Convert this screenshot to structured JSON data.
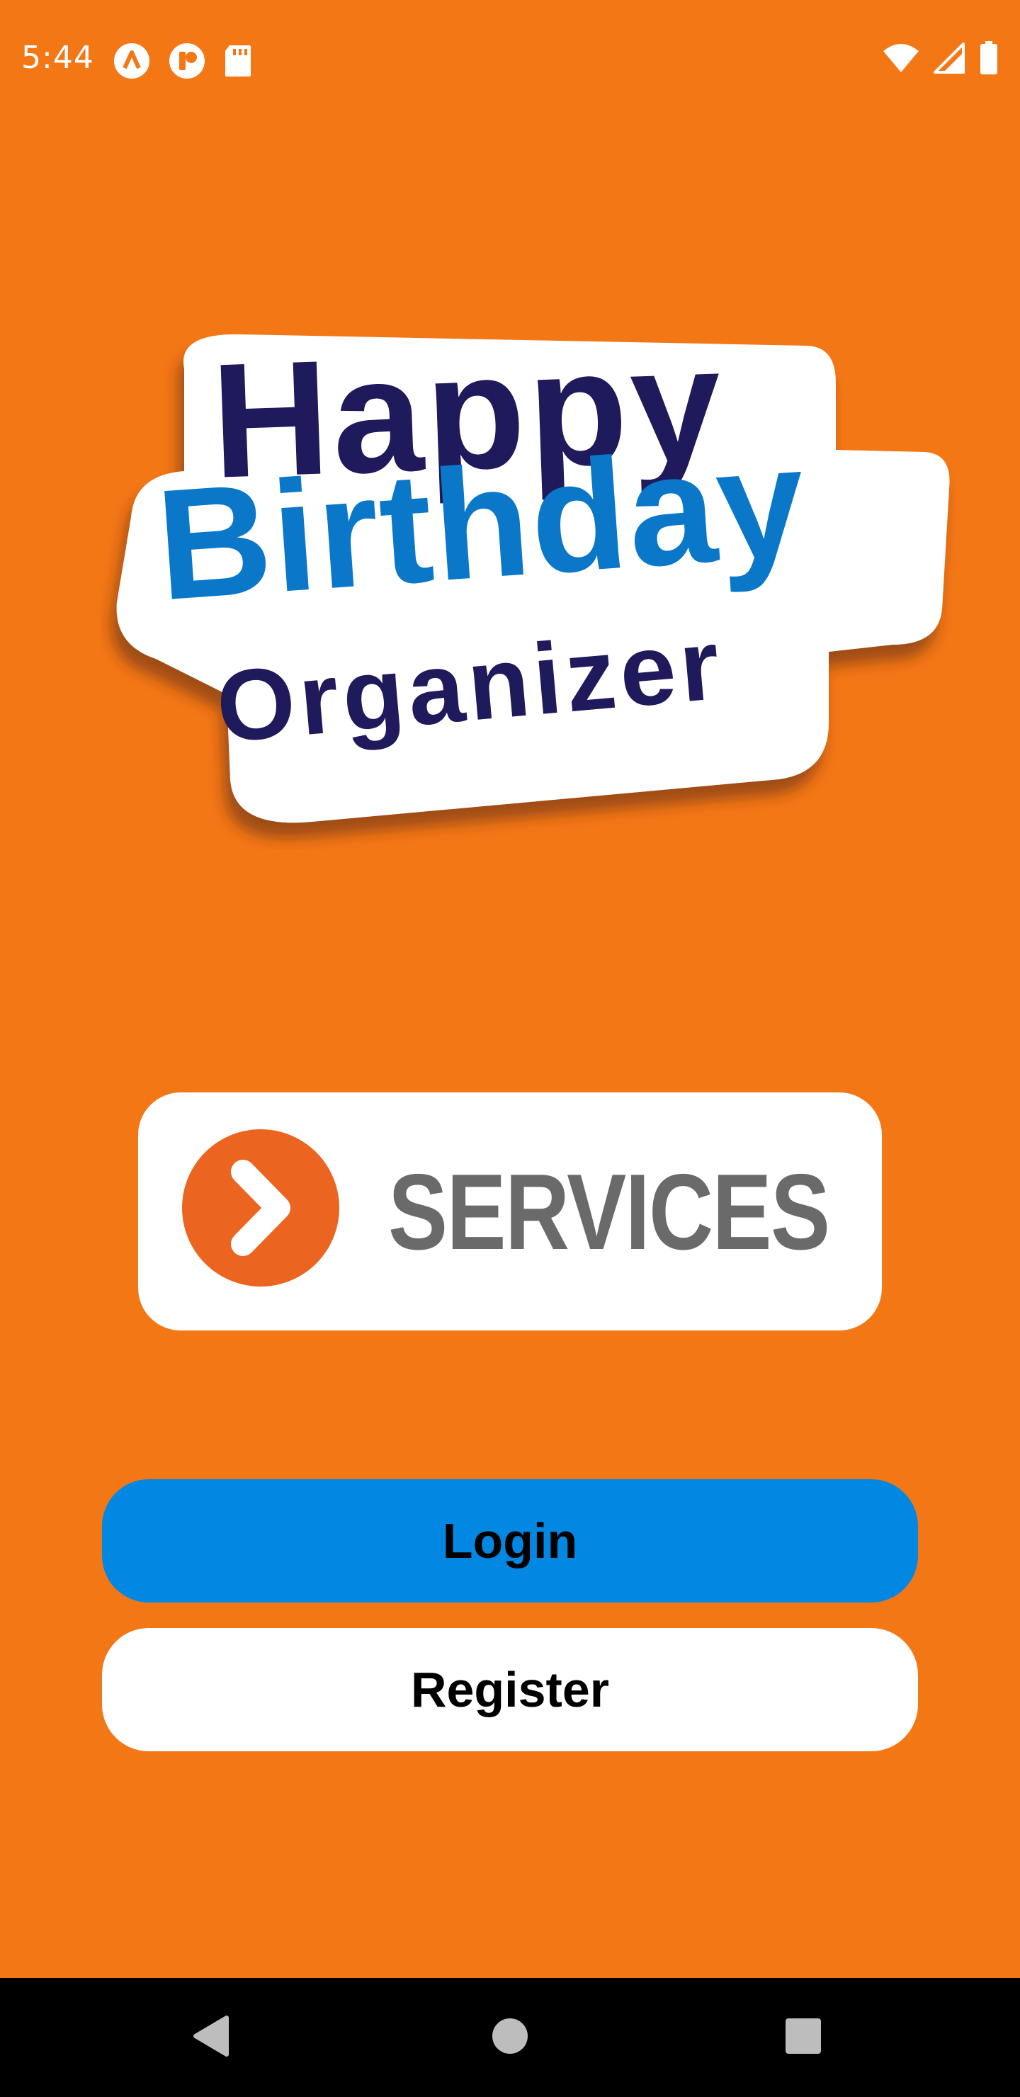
{
  "status_bar": {
    "time": "5:44",
    "left_icons": [
      "app-a-icon",
      "app-p-icon",
      "sd-card-icon"
    ],
    "right_icons": [
      "wifi-icon",
      "cellular-signal-icon",
      "battery-icon"
    ]
  },
  "logo": {
    "line1": "Happy",
    "line2": "Birthday",
    "line3": "Organizer",
    "colors": {
      "happy": "#1E1A5C",
      "birthday": "#0A77C9",
      "organizer": "#1E1A5C"
    }
  },
  "services": {
    "label": "SERVICES",
    "icon": "chevron-right-circle-icon",
    "accent": "#EB6420"
  },
  "buttons": {
    "login": "Login",
    "register": "Register"
  },
  "colors": {
    "background": "#F47716",
    "login_button": "#0288E3",
    "register_button": "#FFFFFF"
  },
  "nav_bar": {
    "icons": [
      "back-icon",
      "home-icon",
      "recents-icon"
    ]
  }
}
